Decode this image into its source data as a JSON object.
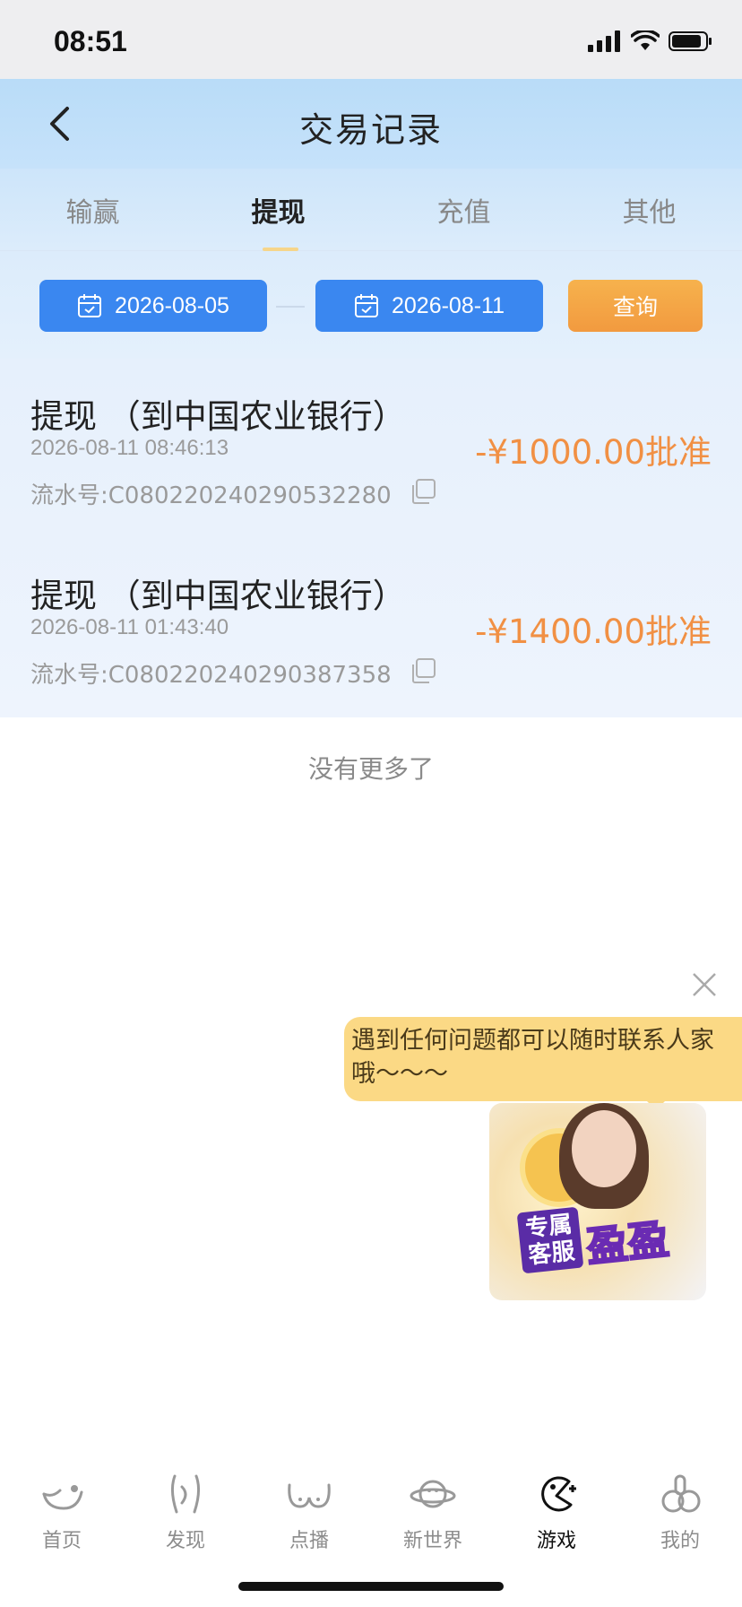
{
  "status_bar": {
    "time": "08:51"
  },
  "header": {
    "title": "交易记录"
  },
  "tabs": [
    {
      "label": "输赢",
      "active": false
    },
    {
      "label": "提现",
      "active": true
    },
    {
      "label": "充值",
      "active": false
    },
    {
      "label": "其他",
      "active": false
    }
  ],
  "filter": {
    "start_date": "2026-08-05",
    "end_date": "2026-08-11",
    "query_label": "查询"
  },
  "records": [
    {
      "title": "提现 （到中国农业银行）",
      "time": "2026-08-11 08:46:13",
      "serial": "流水号:C080220240290532280",
      "amount": "-¥1000.00批准"
    },
    {
      "title": "提现 （到中国农业银行）",
      "time": "2026-08-11 01:43:40",
      "serial": "流水号:C080220240290387358",
      "amount": "-¥1400.00批准"
    }
  ],
  "list_end": "没有更多了",
  "customer_service": {
    "message": "遇到任何问题都可以随时联系人家哦～～～",
    "badge_small": "专属客服",
    "badge_big": "盈盈"
  },
  "bottom_nav": [
    {
      "label": "首页",
      "icon": "home-icon",
      "active": false
    },
    {
      "label": "发现",
      "icon": "discover-icon",
      "active": false
    },
    {
      "label": "点播",
      "icon": "on-demand-icon",
      "active": false
    },
    {
      "label": "新世界",
      "icon": "planet-icon",
      "active": false
    },
    {
      "label": "游戏",
      "icon": "game-icon",
      "active": true
    },
    {
      "label": "我的",
      "icon": "profile-icon",
      "active": false
    }
  ],
  "colors": {
    "accent_blue": "#3a87f0",
    "accent_orange": "#f29a3f",
    "amount_orange": "#f19044",
    "bubble_yellow": "#fbd985"
  }
}
